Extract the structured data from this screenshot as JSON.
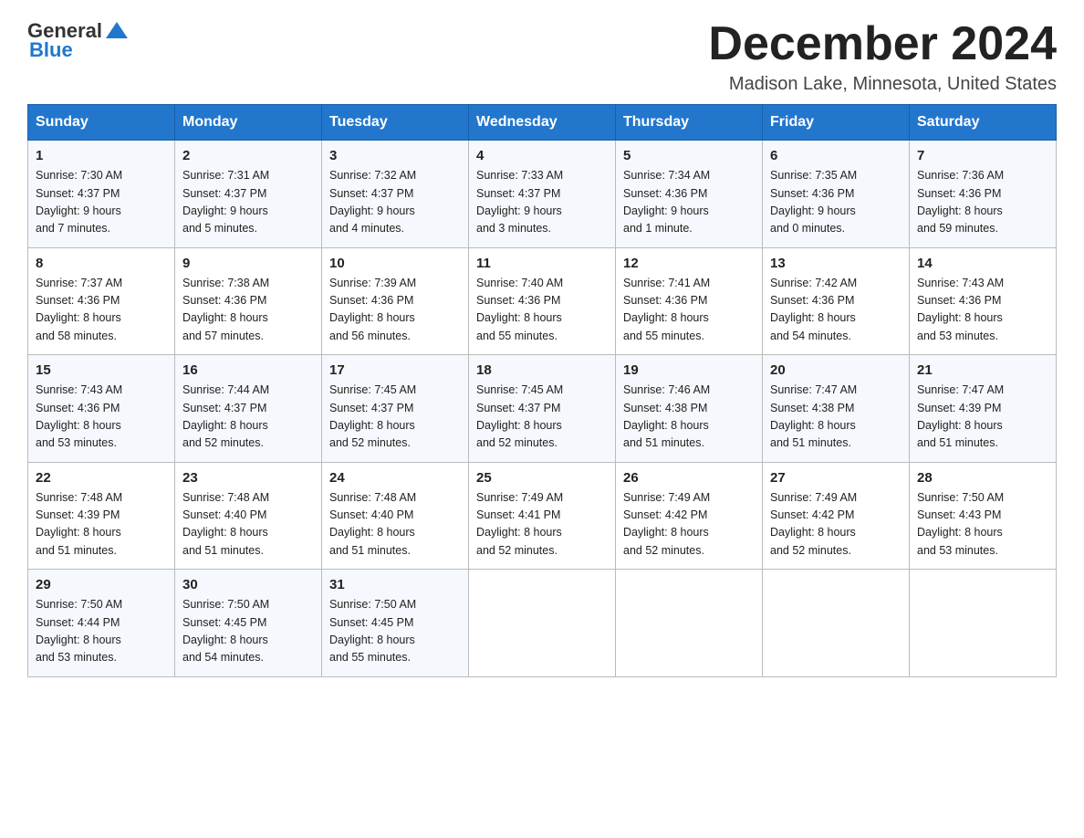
{
  "header": {
    "logo_general": "General",
    "logo_blue": "Blue",
    "month_title": "December 2024",
    "location": "Madison Lake, Minnesota, United States"
  },
  "days_of_week": [
    "Sunday",
    "Monday",
    "Tuesday",
    "Wednesday",
    "Thursday",
    "Friday",
    "Saturday"
  ],
  "weeks": [
    [
      {
        "day": "1",
        "sunrise": "7:30 AM",
        "sunset": "4:37 PM",
        "daylight": "9 hours and 7 minutes."
      },
      {
        "day": "2",
        "sunrise": "7:31 AM",
        "sunset": "4:37 PM",
        "daylight": "9 hours and 5 minutes."
      },
      {
        "day": "3",
        "sunrise": "7:32 AM",
        "sunset": "4:37 PM",
        "daylight": "9 hours and 4 minutes."
      },
      {
        "day": "4",
        "sunrise": "7:33 AM",
        "sunset": "4:37 PM",
        "daylight": "9 hours and 3 minutes."
      },
      {
        "day": "5",
        "sunrise": "7:34 AM",
        "sunset": "4:36 PM",
        "daylight": "9 hours and 1 minute."
      },
      {
        "day": "6",
        "sunrise": "7:35 AM",
        "sunset": "4:36 PM",
        "daylight": "9 hours and 0 minutes."
      },
      {
        "day": "7",
        "sunrise": "7:36 AM",
        "sunset": "4:36 PM",
        "daylight": "8 hours and 59 minutes."
      }
    ],
    [
      {
        "day": "8",
        "sunrise": "7:37 AM",
        "sunset": "4:36 PM",
        "daylight": "8 hours and 58 minutes."
      },
      {
        "day": "9",
        "sunrise": "7:38 AM",
        "sunset": "4:36 PM",
        "daylight": "8 hours and 57 minutes."
      },
      {
        "day": "10",
        "sunrise": "7:39 AM",
        "sunset": "4:36 PM",
        "daylight": "8 hours and 56 minutes."
      },
      {
        "day": "11",
        "sunrise": "7:40 AM",
        "sunset": "4:36 PM",
        "daylight": "8 hours and 55 minutes."
      },
      {
        "day": "12",
        "sunrise": "7:41 AM",
        "sunset": "4:36 PM",
        "daylight": "8 hours and 55 minutes."
      },
      {
        "day": "13",
        "sunrise": "7:42 AM",
        "sunset": "4:36 PM",
        "daylight": "8 hours and 54 minutes."
      },
      {
        "day": "14",
        "sunrise": "7:43 AM",
        "sunset": "4:36 PM",
        "daylight": "8 hours and 53 minutes."
      }
    ],
    [
      {
        "day": "15",
        "sunrise": "7:43 AM",
        "sunset": "4:36 PM",
        "daylight": "8 hours and 53 minutes."
      },
      {
        "day": "16",
        "sunrise": "7:44 AM",
        "sunset": "4:37 PM",
        "daylight": "8 hours and 52 minutes."
      },
      {
        "day": "17",
        "sunrise": "7:45 AM",
        "sunset": "4:37 PM",
        "daylight": "8 hours and 52 minutes."
      },
      {
        "day": "18",
        "sunrise": "7:45 AM",
        "sunset": "4:37 PM",
        "daylight": "8 hours and 52 minutes."
      },
      {
        "day": "19",
        "sunrise": "7:46 AM",
        "sunset": "4:38 PM",
        "daylight": "8 hours and 51 minutes."
      },
      {
        "day": "20",
        "sunrise": "7:47 AM",
        "sunset": "4:38 PM",
        "daylight": "8 hours and 51 minutes."
      },
      {
        "day": "21",
        "sunrise": "7:47 AM",
        "sunset": "4:39 PM",
        "daylight": "8 hours and 51 minutes."
      }
    ],
    [
      {
        "day": "22",
        "sunrise": "7:48 AM",
        "sunset": "4:39 PM",
        "daylight": "8 hours and 51 minutes."
      },
      {
        "day": "23",
        "sunrise": "7:48 AM",
        "sunset": "4:40 PM",
        "daylight": "8 hours and 51 minutes."
      },
      {
        "day": "24",
        "sunrise": "7:48 AM",
        "sunset": "4:40 PM",
        "daylight": "8 hours and 51 minutes."
      },
      {
        "day": "25",
        "sunrise": "7:49 AM",
        "sunset": "4:41 PM",
        "daylight": "8 hours and 52 minutes."
      },
      {
        "day": "26",
        "sunrise": "7:49 AM",
        "sunset": "4:42 PM",
        "daylight": "8 hours and 52 minutes."
      },
      {
        "day": "27",
        "sunrise": "7:49 AM",
        "sunset": "4:42 PM",
        "daylight": "8 hours and 52 minutes."
      },
      {
        "day": "28",
        "sunrise": "7:50 AM",
        "sunset": "4:43 PM",
        "daylight": "8 hours and 53 minutes."
      }
    ],
    [
      {
        "day": "29",
        "sunrise": "7:50 AM",
        "sunset": "4:44 PM",
        "daylight": "8 hours and 53 minutes."
      },
      {
        "day": "30",
        "sunrise": "7:50 AM",
        "sunset": "4:45 PM",
        "daylight": "8 hours and 54 minutes."
      },
      {
        "day": "31",
        "sunrise": "7:50 AM",
        "sunset": "4:45 PM",
        "daylight": "8 hours and 55 minutes."
      },
      null,
      null,
      null,
      null
    ]
  ],
  "labels": {
    "sunrise": "Sunrise:",
    "sunset": "Sunset:",
    "daylight": "Daylight:"
  }
}
